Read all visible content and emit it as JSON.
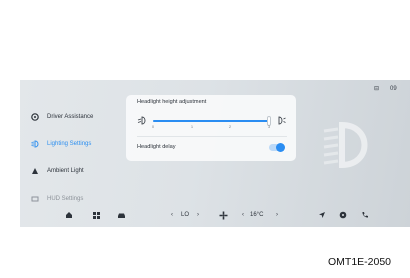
{
  "sidebar": {
    "items": [
      {
        "label": "Driver Assistance",
        "icon": "steering-wheel-icon",
        "active": false
      },
      {
        "label": "Lighting Settings",
        "icon": "headlight-icon",
        "active": true
      },
      {
        "label": "Ambient Light",
        "icon": "ambient-light-icon",
        "active": false
      },
      {
        "label": "HUD Settings",
        "icon": "hud-icon",
        "active": false
      }
    ]
  },
  "panel": {
    "height_title": "Headlight height adjustment",
    "slider": {
      "ticks": [
        "0",
        "1",
        "2",
        "3"
      ],
      "value": 3,
      "min": 0,
      "max": 3
    },
    "delay_label": "Headlight delay",
    "delay_on": true
  },
  "bottom_bar": {
    "fan_value": "LO",
    "fan_left_arrow": "‹",
    "fan_right_arrow": "›",
    "temperature": "16°C",
    "temp_left_arrow": "‹",
    "temp_right_arrow": "›"
  },
  "status_bar": {
    "signal": "⊟",
    "time": "09"
  },
  "caption": "OMT1E-2050",
  "colors": {
    "accent": "#2a8df2",
    "background": "#e0e4e7",
    "text": "#2d333b"
  }
}
